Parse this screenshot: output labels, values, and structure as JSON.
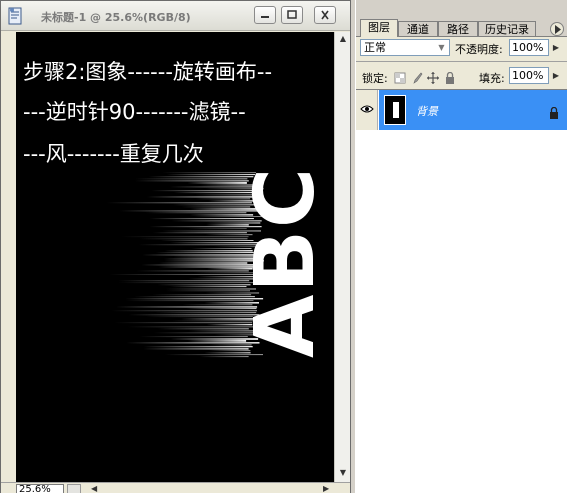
{
  "document": {
    "title": "未标题-1 @ 25.6%(RGB/8)",
    "canvas_text": {
      "line1": "步骤2:图象------旋转画布--",
      "line2": "---逆时针90-------滤镜--",
      "line3": "---风-------重复几次"
    },
    "zoom": "25.6%"
  },
  "panel": {
    "tabs": {
      "layers": "图层",
      "channels": "通道",
      "paths": "路径",
      "history": "历史记录"
    },
    "blend_mode": "正常",
    "opacity_label": "不透明度:",
    "opacity_value": "100%",
    "lock_label": "锁定:",
    "fill_label": "填充:",
    "fill_value": "100%",
    "layer": {
      "name": "背景"
    }
  },
  "colors": {
    "selection": "#3a90f5",
    "canvas_bg": "#000000"
  }
}
